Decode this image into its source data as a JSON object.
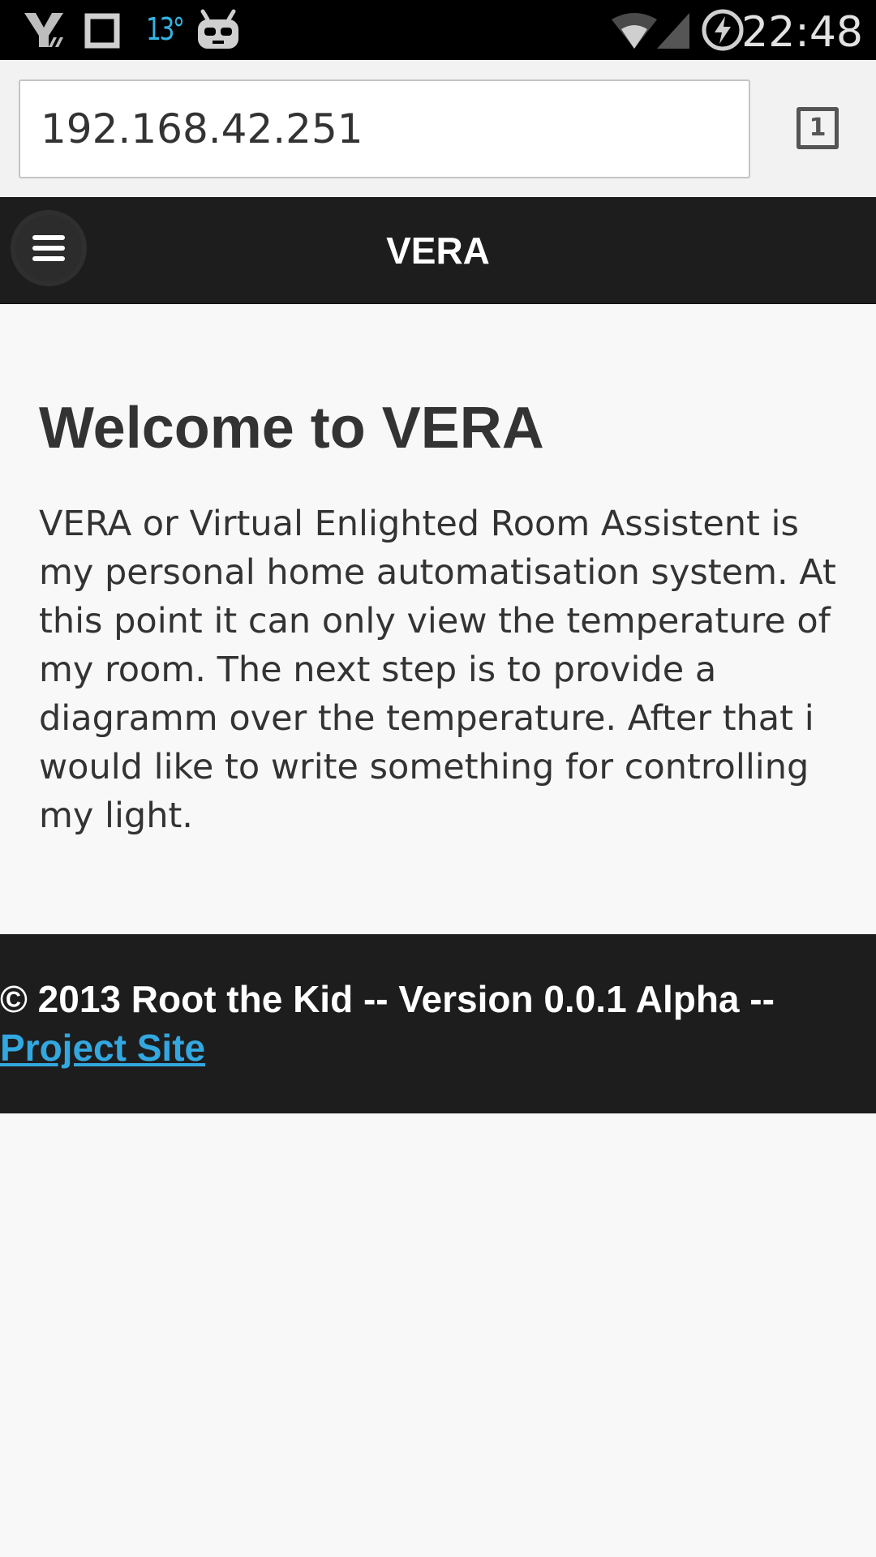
{
  "status_bar": {
    "left_icons": [
      "network-provider-icon",
      "screenshot-icon",
      "weather-icon",
      "android-icon"
    ],
    "temperature": "13°",
    "right_icons": [
      "wifi-icon",
      "cell-signal-icon",
      "battery-charging-icon"
    ],
    "clock": "22:48"
  },
  "browser": {
    "url": "192.168.42.251",
    "tab_count": "1"
  },
  "header": {
    "title": "VERA",
    "menu_icon": "hamburger-menu-icon"
  },
  "main": {
    "heading": "Welcome to VERA",
    "paragraph": "VERA or Virtual Enlighted Room Assistent is my personal home automatisation system. At this point it can only view the temperature of my room. The next step is to provide a diagramm over the temperature. After that i would like to write something for controlling my light."
  },
  "footer": {
    "copyright": "© 2013 Root the Kid -- Version 0.0.1 Alpha -- ",
    "link_label": "Project Site"
  },
  "colors": {
    "status_bar_bg": "#000000",
    "header_bg": "#1d1d1d",
    "page_bg": "#f8f8f8",
    "link": "#33a8e0",
    "accent": "#33b5e5"
  }
}
